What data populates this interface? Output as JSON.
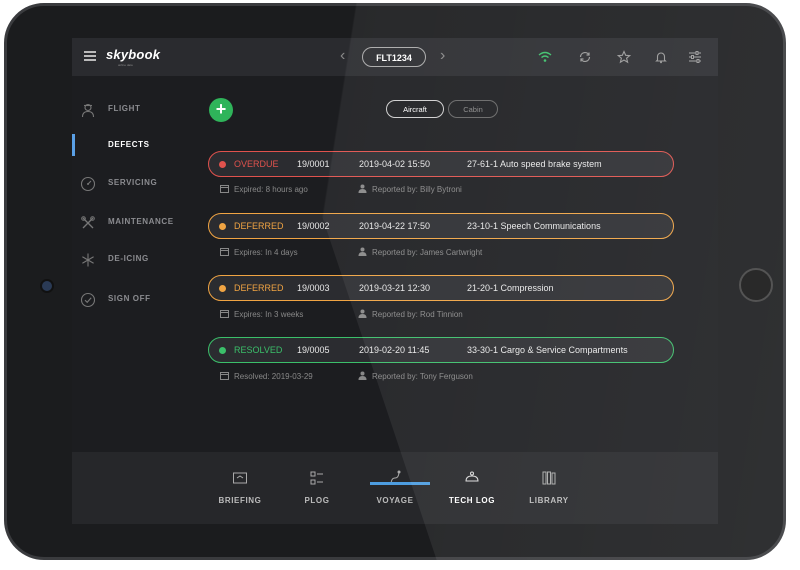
{
  "header": {
    "brand": "skybook",
    "brand_sub": "airline data",
    "flight": "FLT1234",
    "prev": "‹",
    "next": "›",
    "icons": [
      "wifi-icon",
      "sync-icon",
      "star-icon",
      "bell-icon",
      "settings-sliders-icon"
    ]
  },
  "sidebar": {
    "items": [
      {
        "label": "FLIGHT",
        "icon": "pilot-icon"
      },
      {
        "label": "DEFECTS",
        "icon": "none"
      },
      {
        "label": "SERVICING",
        "icon": "gauge-icon"
      },
      {
        "label": "MAINTENANCE",
        "icon": "tools-icon"
      },
      {
        "label": "DE-ICING",
        "icon": "snowflake-icon"
      },
      {
        "label": "SIGN OFF",
        "icon": "check-circle-icon"
      }
    ],
    "active": "DEFECTS"
  },
  "add_label": "+",
  "segments": {
    "aircraft": "Aircraft",
    "cabin": "Cabin",
    "selected": "Aircraft"
  },
  "defects": [
    {
      "status": "OVERDUE",
      "number": "19/0001",
      "date": "2019-04-02 15:50",
      "description": "27-61-1 Auto speed brake system",
      "expiry": "Expired: 8 hours ago",
      "reported": "Reported by: Billy Bytroni"
    },
    {
      "status": "DEFERRED",
      "number": "19/0002",
      "date": "2019-04-22 17:50",
      "description": "23-10-1 Speech Communications",
      "expiry": "Expires: In 4 days",
      "reported": "Reported by: James Cartwright"
    },
    {
      "status": "DEFERRED",
      "number": "19/0003",
      "date": "2019-03-21 12:30",
      "description": "21-20-1 Compression",
      "expiry": "Expires: In 3 weeks",
      "reported": "Reported by: Rod Tinnion"
    },
    {
      "status": "RESOLVED",
      "number": "19/0005",
      "date": "2019-02-20 11:45",
      "description": "33-30-1 Cargo & Service Compartments",
      "expiry": "Resolved: 2019-03-29",
      "reported": "Reported by: Tony Ferguson"
    }
  ],
  "colors": {
    "overdue": "#e0524d",
    "deferred": "#f0a443",
    "resolved": "#3bbf6a",
    "accent": "#4d9de0",
    "add": "#2fb45a"
  },
  "tabs": [
    {
      "label": "BRIEFING",
      "icon": "briefing-icon"
    },
    {
      "label": "PLOG",
      "icon": "plog-icon"
    },
    {
      "label": "VOYAGE",
      "icon": "voyage-icon"
    },
    {
      "label": "TECH LOG",
      "icon": "techlog-icon"
    },
    {
      "label": "LIBRARY",
      "icon": "library-icon"
    }
  ],
  "active_tab": "TECH LOG"
}
